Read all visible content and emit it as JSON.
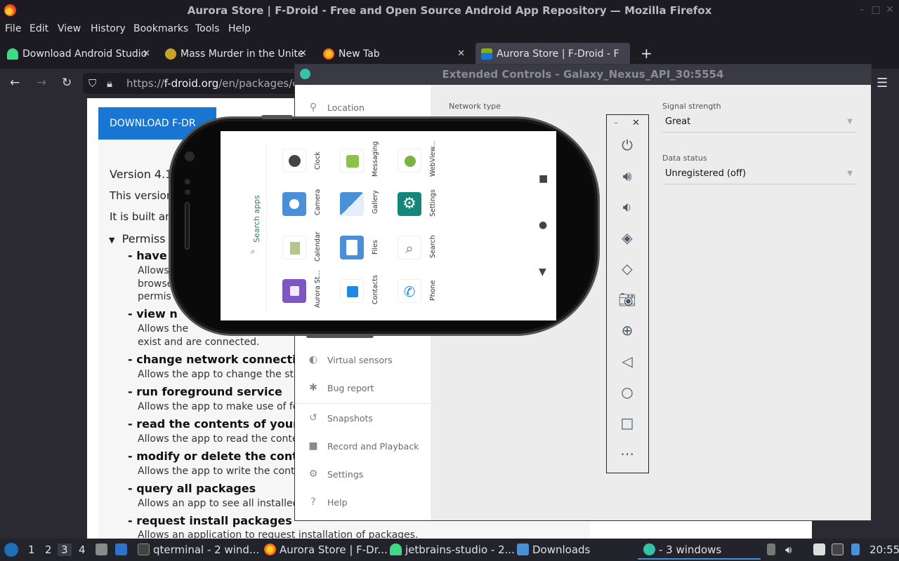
{
  "window": {
    "title": "Aurora Store | F-Droid - Free and Open Source Android App Repository — Mozilla Firefox"
  },
  "menu": [
    "File",
    "Edit",
    "View",
    "History",
    "Bookmarks",
    "Tools",
    "Help"
  ],
  "tabs": [
    {
      "label": "Download Android Studio",
      "color": "#3ddc84"
    },
    {
      "label": "Mass Murder in the Unite",
      "color": "#c9a227"
    },
    {
      "label": "New Tab",
      "color": "#ff6a00"
    },
    {
      "label": "Aurora Store | F-Droid - F",
      "color": "#2f6fc6"
    }
  ],
  "url": {
    "prefix": "https://",
    "host": "f-droid.org",
    "path": "/en/packages/co"
  },
  "page": {
    "download_label": "DOWNLOAD F-DR",
    "version": "Version 4.1",
    "line1": "This version",
    "line2": "It is built an",
    "permissions_label": "Permiss",
    "perm_have": "have",
    "perm_have_d1": "Allows",
    "perm_have_d2": "browse",
    "perm_have_d3": "permis",
    "perm_view": "view n",
    "perm_view_d1": "Allows the",
    "perm_view_d2": "exist and are connected.",
    "permissions": [
      {
        "title": "change network connectivity",
        "desc": "Allows the app to change the state"
      },
      {
        "title": "run foreground service",
        "desc": "Allows the app to make use of fore"
      },
      {
        "title": "read the contents of your shar",
        "desc": "Allows the app to read the contents"
      },
      {
        "title": "modify or delete the contents",
        "desc": "Allows the app to write the content"
      },
      {
        "title": "query all packages",
        "desc": "Allows an app to see all installed pa"
      },
      {
        "title": "request install packages",
        "desc": "Allows an application to request installation of packages."
      }
    ]
  },
  "extended": {
    "title": "Extended Controls - Galaxy_Nexus_API_30:5554",
    "sidebar": [
      {
        "label": "Location",
        "icon": "location-pin-icon"
      },
      {
        "label": "Virtual sensors",
        "icon": "sensor-icon"
      },
      {
        "label": "Bug report",
        "icon": "bug-icon"
      },
      {
        "label": "Snapshots",
        "icon": "history-icon"
      },
      {
        "label": "Record and Playback",
        "icon": "video-icon"
      },
      {
        "label": "Settings",
        "icon": "gear-icon"
      },
      {
        "label": "Help",
        "icon": "help-icon"
      }
    ],
    "network_type_label": "Network type",
    "signal_strength_label": "Signal strength",
    "signal_strength_value": "Great",
    "data_status_label": "Data status",
    "data_status_value": "Unregistered (off)"
  },
  "emulator_toolbar": [
    "power-icon",
    "volume-up-icon",
    "volume-down-icon",
    "rotate-left-icon",
    "rotate-right-icon",
    "camera-icon",
    "zoom-icon",
    "back-icon",
    "home-icon",
    "overview-icon",
    "more-icon"
  ],
  "phone": {
    "search_label": "Search apps",
    "apps": [
      "Clock",
      "Messaging",
      "WebView...",
      "Camera",
      "Gallery",
      "Settings",
      "Calendar",
      "Files",
      "Search",
      "Aurora St...",
      "Contacts",
      "Phone"
    ]
  },
  "taskbar": {
    "workspaces": [
      "1",
      "2",
      "3",
      "4"
    ],
    "items": [
      "qterminal - 2 wind...",
      "Aurora Store | F-Dr...",
      "jetbrains-studio - 2...",
      "Downloads",
      "- 3 windows"
    ],
    "time": "20:55"
  }
}
